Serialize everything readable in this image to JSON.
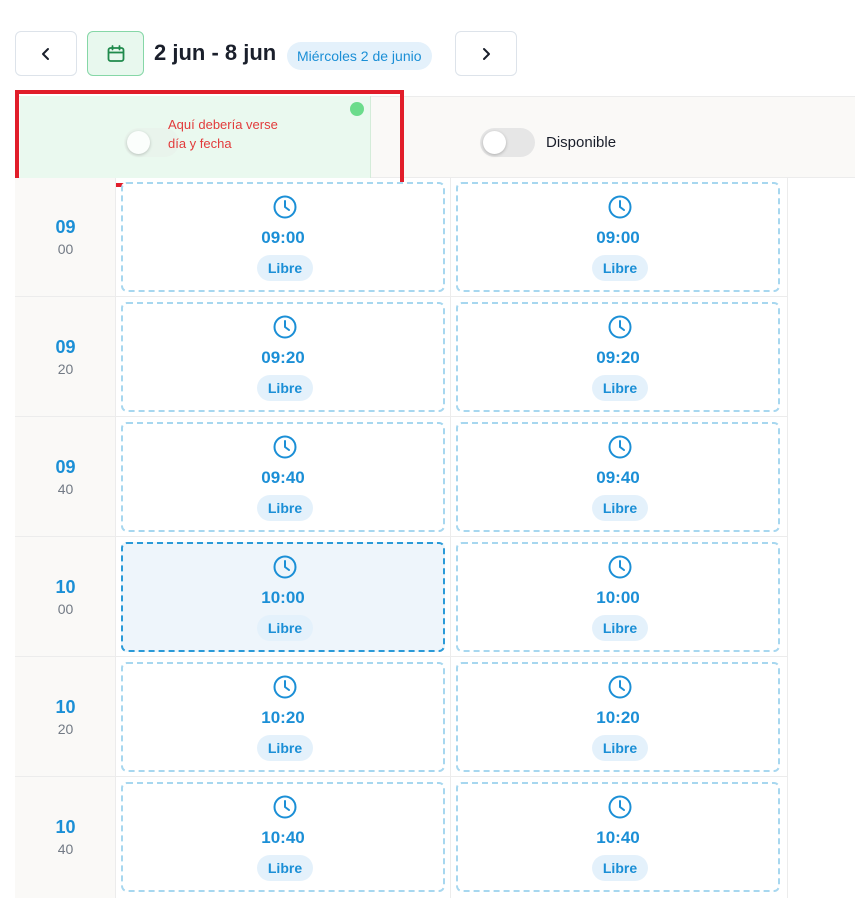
{
  "toolbar": {
    "prev_icon": "chevron-left-icon",
    "calendar_icon": "calendar-icon",
    "range_title": "2 jun - 8 jun",
    "date_pill": "Miércoles 2 de junio",
    "next_icon": "chevron-right-icon"
  },
  "header": {
    "annotation": "Aquí debería verse día y fecha",
    "annotation_color": "#e11d2a",
    "availability_label": "Disponible"
  },
  "rows": [
    {
      "hh": "09",
      "mm": "00",
      "slots": [
        {
          "time": "09:00",
          "status": "Libre"
        },
        {
          "time": "09:00",
          "status": "Libre"
        }
      ]
    },
    {
      "hh": "09",
      "mm": "20",
      "slots": [
        {
          "time": "09:20",
          "status": "Libre"
        },
        {
          "time": "09:20",
          "status": "Libre"
        }
      ]
    },
    {
      "hh": "09",
      "mm": "40",
      "slots": [
        {
          "time": "09:40",
          "status": "Libre"
        },
        {
          "time": "09:40",
          "status": "Libre"
        }
      ]
    },
    {
      "hh": "10",
      "mm": "00",
      "slots": [
        {
          "time": "10:00",
          "status": "Libre"
        },
        {
          "time": "10:00",
          "status": "Libre"
        }
      ]
    },
    {
      "hh": "10",
      "mm": "20",
      "slots": [
        {
          "time": "10:20",
          "status": "Libre"
        },
        {
          "time": "10:20",
          "status": "Libre"
        }
      ]
    },
    {
      "hh": "10",
      "mm": "40",
      "slots": [
        {
          "time": "10:40",
          "status": "Libre"
        },
        {
          "time": "10:40",
          "status": "Libre"
        }
      ]
    }
  ],
  "colors": {
    "accent": "#1b8fd6",
    "calendar_button": "#e8f8ee",
    "slot_border": "#a7d7ef"
  }
}
